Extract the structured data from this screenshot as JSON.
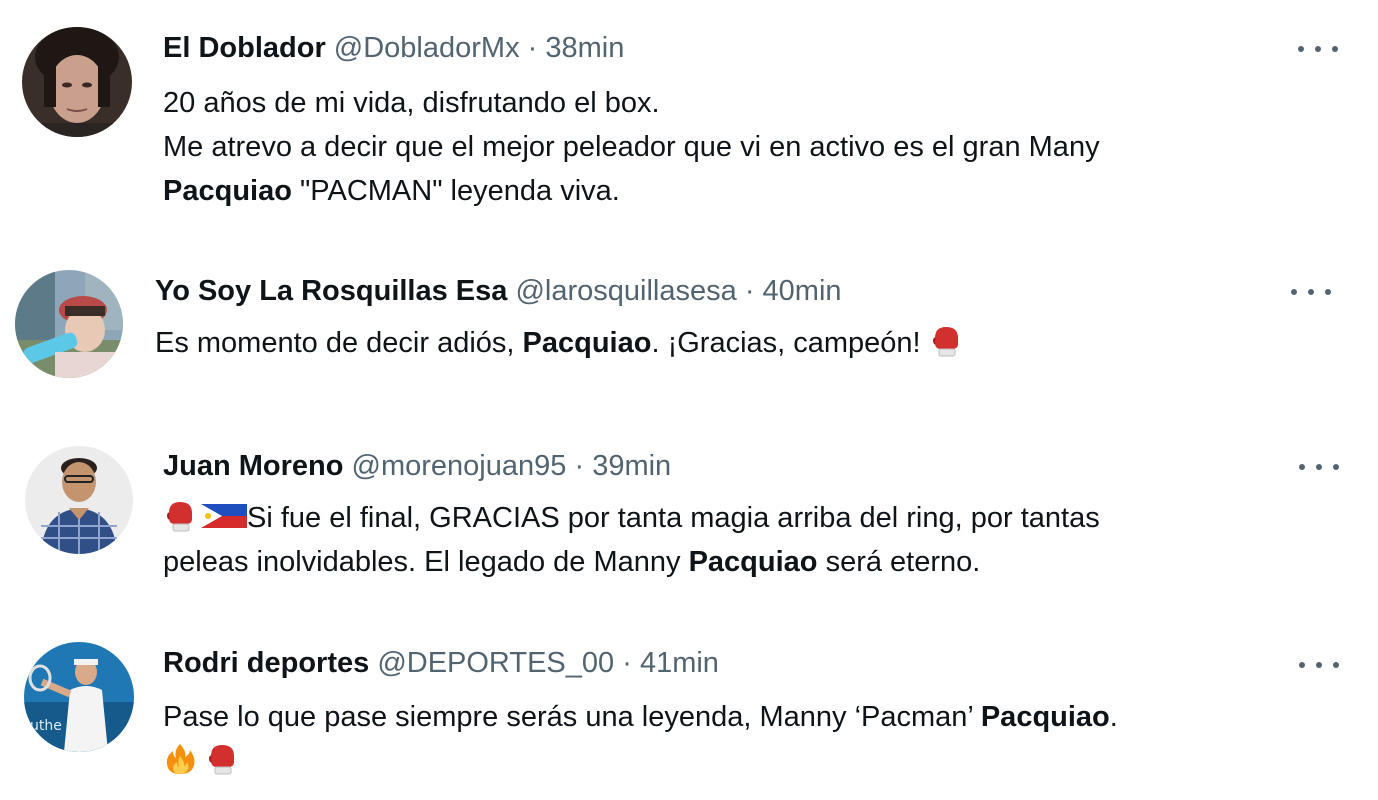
{
  "tweets": [
    {
      "name": "El Doblador",
      "handle": "@DobladorMx",
      "separator": "·",
      "time": "38min",
      "text": {
        "line1": "20 años de mi vida, disfrutando el box.",
        "line2": "Me atrevo a decir que el mejor peleador que vi en activo es el gran Many",
        "line3_bold": "Pacquiao",
        "line3_rest": " \"PACMAN\" leyenda viva."
      }
    },
    {
      "name": "Yo Soy La Rosquillas Esa",
      "handle": "@larosquillasesa",
      "separator": "·",
      "time": "40min",
      "text": {
        "before": "Es momento de decir adiós, ",
        "bold": "Pacquiao",
        "after": ". ¡Gracias, campeón! "
      },
      "emojis": [
        "boxing-glove"
      ]
    },
    {
      "name": "Juan Moreno",
      "handle": "@morenojuan95",
      "separator": "·",
      "time": "39min",
      "text": {
        "line1": "Si fue el final, GRACIAS por tanta magia arriba del ring, por tantas",
        "line2_before": "peleas inolvidables. El legado de Manny ",
        "line2_bold": "Pacquiao",
        "line2_after": " será eterno."
      },
      "emojis": [
        "boxing-glove",
        "philippines-flag"
      ]
    },
    {
      "name": "Rodri deportes",
      "handle": "@DEPORTES_00",
      "separator": "·",
      "time": "41min",
      "text": {
        "line1_before": "Pase lo que pase siempre serás una leyenda, Manny ‘Pacman’ ",
        "line1_bold": "Pacquiao",
        "line1_after": "."
      },
      "emojis": [
        "fire",
        "boxing-glove"
      ]
    }
  ],
  "icons": {
    "more": "more-horizontal-icon"
  },
  "colors": {
    "primary_text": "#0f1419",
    "secondary_text": "#536471",
    "background": "#ffffff"
  }
}
